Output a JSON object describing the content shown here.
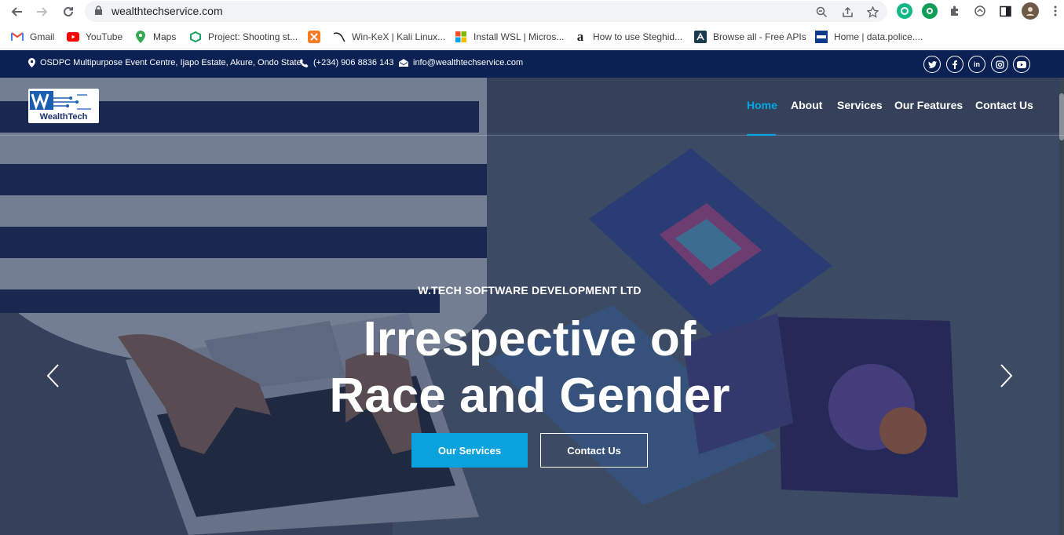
{
  "browser": {
    "url": "wealthtechservice.com",
    "bookmarks": [
      {
        "label": "Gmail",
        "icon": "gmail-icon",
        "color": "#ea4335"
      },
      {
        "label": "YouTube",
        "icon": "youtube-icon",
        "color": "#ff0000"
      },
      {
        "label": "Maps",
        "icon": "maps-icon",
        "color": "#34a853"
      },
      {
        "label": "Project: Shooting st...",
        "icon": "project-icon",
        "color": "#1aa260"
      },
      {
        "label": "",
        "icon": "xampp-icon",
        "color": "#fb7a24"
      },
      {
        "label": "Win-KeX | Kali Linux...",
        "icon": "kali-icon",
        "color": "#202124"
      },
      {
        "label": "Install WSL | Micros...",
        "icon": "microsoft-icon",
        "color": "#f25022"
      },
      {
        "label": "How to use Steghid...",
        "icon": "a-icon",
        "color": "#202124"
      },
      {
        "label": "Browse all - Free APIs",
        "icon": "api-icon",
        "color": "#1b3a4b"
      },
      {
        "label": "Home | data.police....",
        "icon": "police-icon",
        "color": "#0b3c8c"
      }
    ]
  },
  "topbar": {
    "address": "OSDPC Multipurpose Event Centre, Ijapo Estate, Akure, Ondo State.",
    "phone": "(+234) 906 8836 143",
    "email": "info@wealthtechservice.com",
    "social": [
      {
        "icon": "twitter-icon",
        "glyph": "t"
      },
      {
        "icon": "facebook-icon",
        "glyph": "f"
      },
      {
        "icon": "linkedin-icon",
        "glyph": "in"
      },
      {
        "icon": "instagram-icon",
        "glyph": "◎"
      },
      {
        "icon": "youtube-icon",
        "glyph": "▶"
      }
    ]
  },
  "header": {
    "logo_text": "WealthTech",
    "nav": [
      "Home",
      "About",
      "Services",
      "Our Features",
      "Contact Us"
    ]
  },
  "hero": {
    "subtitle": "W.TECH SOFTWARE DEVELOPMENT LTD",
    "headline_line1": "Irrespective of",
    "headline_line2": "Race and Gender",
    "primary_button": "Our Services",
    "secondary_button": "Contact Us"
  },
  "colors": {
    "topbar": "#0b2154",
    "accent": "#00a8e8",
    "primary_button": "#0aa2dc"
  }
}
